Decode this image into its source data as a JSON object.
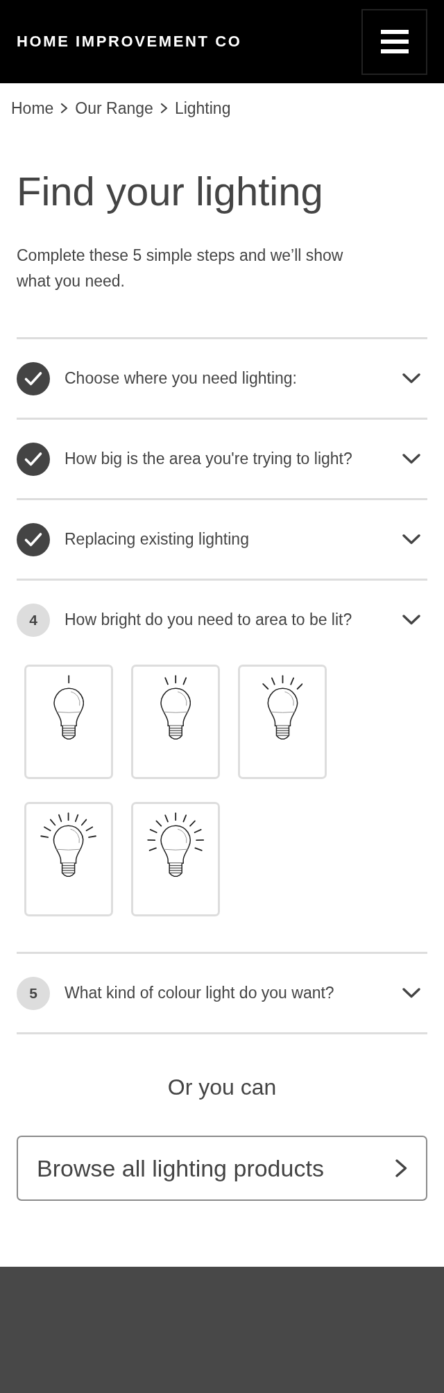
{
  "header": {
    "logo": "HOME IMPROVEMENT CO"
  },
  "breadcrumb": [
    "Home",
    "Our Range",
    "Lighting"
  ],
  "title": "Find your lighting",
  "intro": "Complete these 5 simple steps and we’ll show what you need.",
  "steps": [
    {
      "title": "Choose where you need lighting:",
      "completed": true
    },
    {
      "title": "How big is the area you're trying to light?",
      "completed": true
    },
    {
      "title": "Replacing existing lighting",
      "completed": true
    },
    {
      "number": "4",
      "title": "How bright do you need to area to be lit?",
      "completed": false,
      "options": [
        {
          "kind": "dim"
        },
        {
          "kind": "low"
        },
        {
          "kind": "medium"
        },
        {
          "kind": "bright"
        },
        {
          "kind": "brightest"
        }
      ]
    },
    {
      "number": "5",
      "title": "What kind of colour light do you want?",
      "completed": false
    }
  ],
  "alternative": {
    "heading": "Or you can",
    "button": "Browse all lighting products"
  }
}
